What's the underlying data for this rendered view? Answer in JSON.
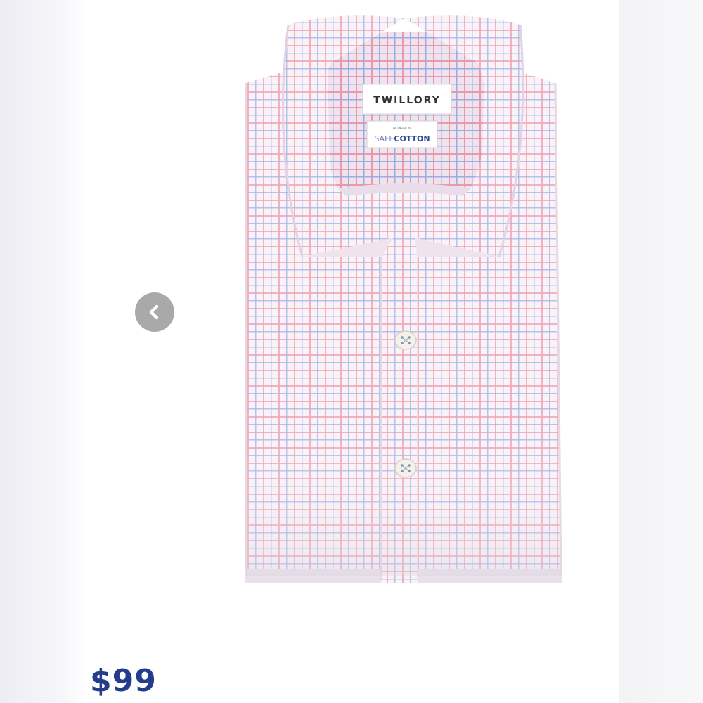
{
  "product": {
    "image": {
      "icon": "shirt-image",
      "brand_label": "TWILLORY",
      "care_label_small": "NON-IRON",
      "care_label_prefix": "SAFE",
      "care_label_suffix": "COTTON",
      "colors": {
        "pink": "#f08aa3",
        "blue": "#9aa9e3",
        "base": "#f9f3f8"
      }
    },
    "price": "$99"
  },
  "carousel": {
    "prev_icon": "chevron-left-icon"
  },
  "colors": {
    "price": "#233c8c",
    "nav_button": "#a9a9a9"
  }
}
